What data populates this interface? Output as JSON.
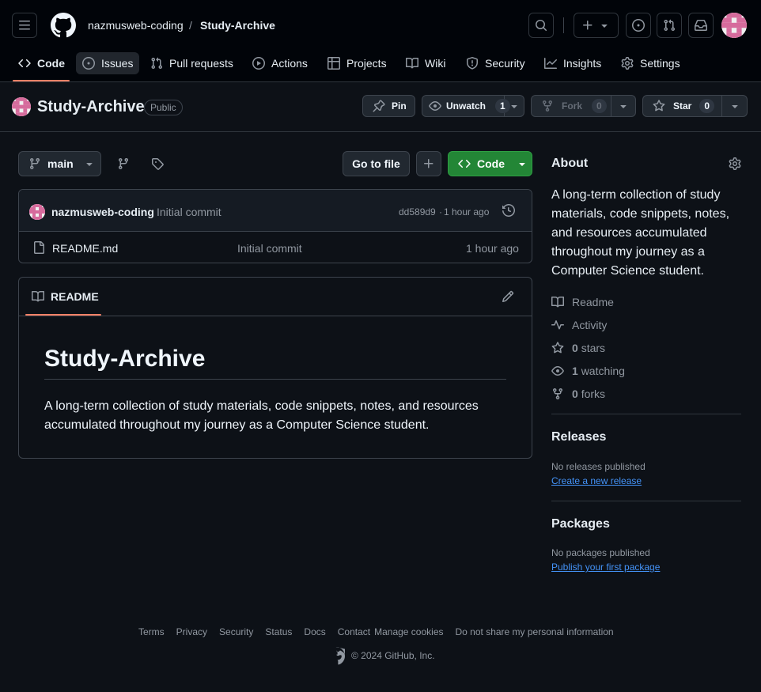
{
  "header": {
    "owner": "nazmusweb-coding",
    "separator": "/",
    "repo": "Study-Archive"
  },
  "nav": {
    "code": "Code",
    "issues": "Issues",
    "pulls": "Pull requests",
    "actions": "Actions",
    "projects": "Projects",
    "wiki": "Wiki",
    "security": "Security",
    "insights": "Insights",
    "settings": "Settings"
  },
  "repo": {
    "name": "Study-Archive",
    "visibility": "Public",
    "pin": "Pin",
    "unwatch": "Unwatch",
    "watch_count": "1",
    "fork": "Fork",
    "fork_count": "0",
    "star": "Star",
    "star_count": "0"
  },
  "toolbar": {
    "branch": "main",
    "go_to_file": "Go to file",
    "code": "Code"
  },
  "commit": {
    "author": "nazmusweb-coding",
    "message": "Initial commit",
    "hash": "dd589d9",
    "dot": "·",
    "time": "1 hour ago"
  },
  "files": [
    {
      "name": "README.md",
      "message": "Initial commit",
      "time": "1 hour ago"
    }
  ],
  "readme": {
    "tab": "README",
    "heading": "Study-Archive",
    "body_line1": "A long-term collection of study materials, code snippets, notes, and resources",
    "body_line2": "accumulated throughout my journey as a Computer Science student."
  },
  "about": {
    "title": "About",
    "desc_lines": [
      "A long-term collection of study",
      "materials, code snippets, notes,",
      "and resources accumulated",
      "throughout my journey as a",
      "Computer Science student."
    ],
    "readme": "Readme",
    "activity": "Activity",
    "stars_count": "0",
    "stars": "stars",
    "watching_count": "1",
    "watching": "watching",
    "forks_count": "0",
    "forks": "forks"
  },
  "releases": {
    "title": "Releases",
    "none": "No releases published",
    "create": "Create a new release"
  },
  "packages": {
    "title": "Packages",
    "none": "No packages published",
    "publish": "Publish your first package"
  },
  "footer": {
    "links": [
      "Terms",
      "Privacy",
      "Security",
      "Status",
      "Docs",
      "Contact",
      "Manage cookies",
      "Do not share my personal information"
    ],
    "copyright": "© 2024 GitHub, Inc."
  },
  "colors": {
    "accent_tab": "#f78166",
    "green_button": "#238636",
    "link": "#4493f8"
  }
}
